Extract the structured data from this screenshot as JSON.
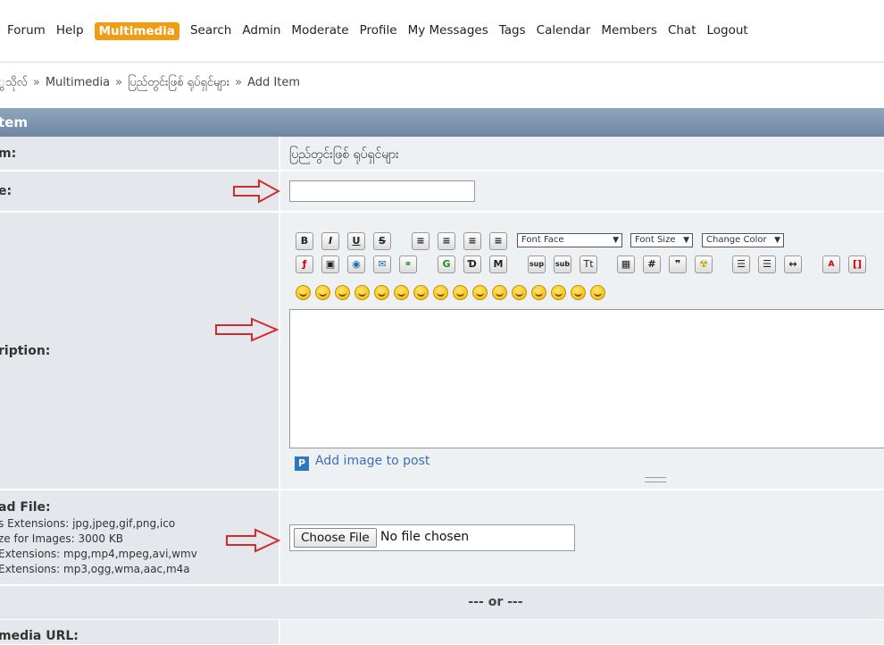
{
  "nav": {
    "items": [
      "Forum",
      "Help",
      "Multimedia",
      "Search",
      "Admin",
      "Moderate",
      "Profile",
      "My Messages",
      "Tags",
      "Calendar",
      "Members",
      "Chat",
      "Logout"
    ],
    "active": "Multimedia"
  },
  "breadcrumb": {
    "items": [
      "ွသိုလ်",
      "Multimedia",
      "ပြည်တွင်းဖြစ် ရုပ်ရှင်များ",
      "Add Item"
    ]
  },
  "header": {
    "title": "tem"
  },
  "rows": {
    "album": {
      "label": "m:",
      "value": "ပြည်တွင်းဖြစ် ရုပ်ရှင်များ"
    },
    "title": {
      "label": "e:",
      "value": ""
    },
    "description": {
      "label": "ription:"
    },
    "upload": {
      "label": "ad File:",
      "notes": [
        "s Extensions: jpg,jpeg,gif,png,ico",
        "ze for Images: 3000 KB",
        "Extensions: mpg,mp4,mpeg,avi,wmv",
        "Extensions: mp3,ogg,wma,aac,m4a"
      ],
      "button_label": "Choose File",
      "status": "No file chosen"
    },
    "or": "--- or ---",
    "url": {
      "label": "media URL:"
    }
  },
  "editor": {
    "font_face": "Font Face",
    "font_size": "Font Size",
    "change_color": "Change Color",
    "add_image_label": "Add image to post",
    "format_buttons": [
      "B",
      "I",
      "U",
      "S"
    ],
    "sup": "sup",
    "sub": "sub"
  },
  "colors": {
    "accent": "#f39c12",
    "header_bar": "#7890aa",
    "arrow": "#d42a2a",
    "link": "#3d6fb5"
  }
}
